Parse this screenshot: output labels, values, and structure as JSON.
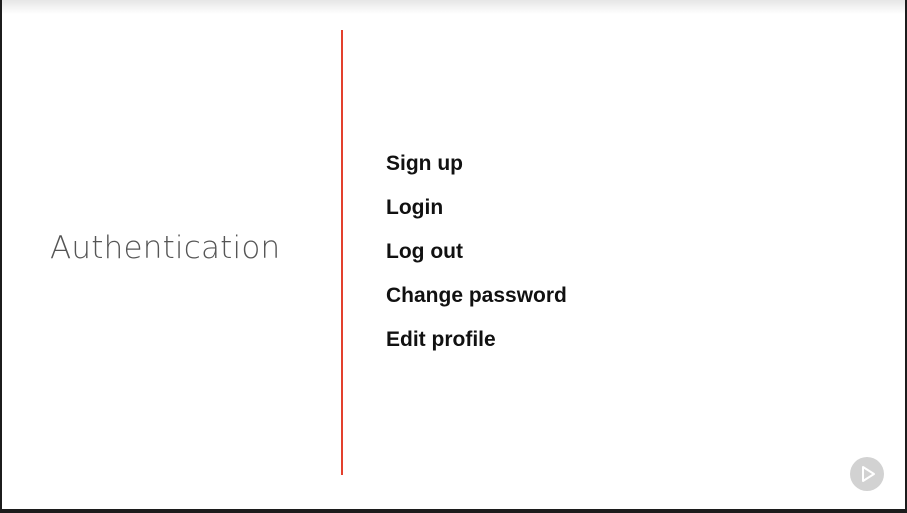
{
  "slide": {
    "section_title": "Authentication",
    "topics": [
      {
        "label": "Sign up"
      },
      {
        "label": "Login"
      },
      {
        "label": "Log out"
      },
      {
        "label": "Change password"
      },
      {
        "label": "Edit profile"
      }
    ]
  },
  "colors": {
    "divider": "#e3402d",
    "title": "#555555",
    "topics": "#111111",
    "play_button": "#d2d2d2"
  },
  "icons": {
    "player_control": "play-icon"
  }
}
